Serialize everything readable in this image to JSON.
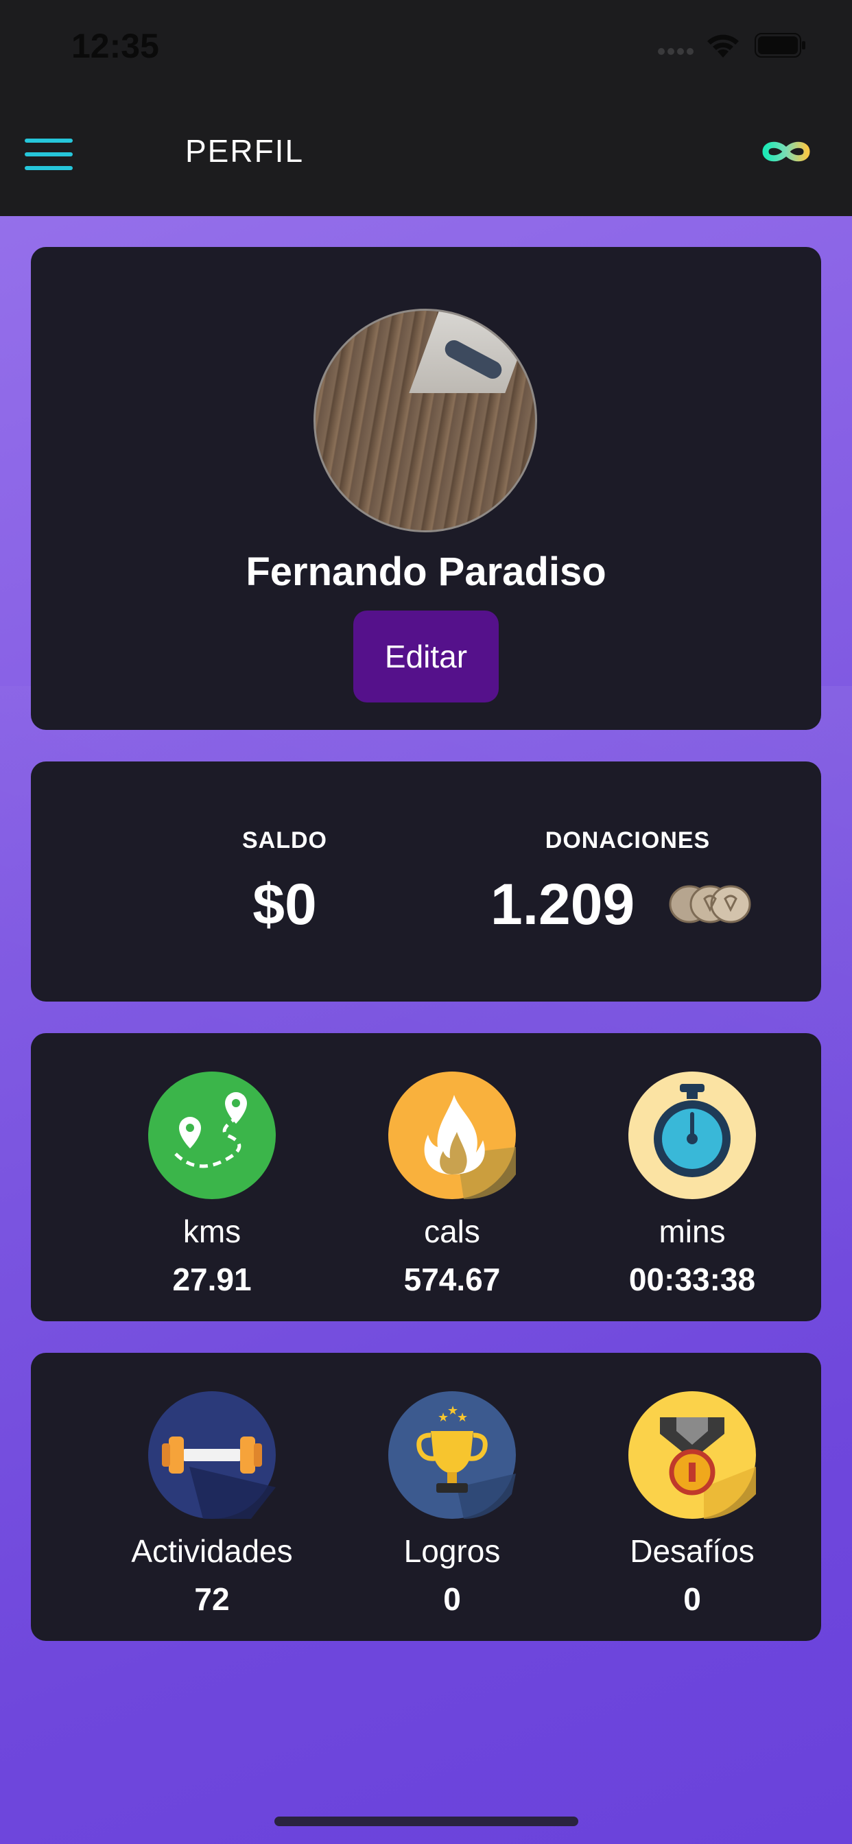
{
  "status_bar": {
    "time": "12:35"
  },
  "nav": {
    "title": "PERFIL",
    "menu_icon": "hamburger-icon",
    "brand_icon": "infinity-logo-icon"
  },
  "profile": {
    "name": "Fernando Paradiso",
    "edit_label": "Editar"
  },
  "balance": {
    "saldo_label": "SALDO",
    "saldo_value": "$0",
    "donaciones_label": "DONACIONES",
    "donaciones_value": "1.209"
  },
  "metrics": [
    {
      "icon": "route-map-icon",
      "label": "kms",
      "value": "27.91"
    },
    {
      "icon": "flame-icon",
      "label": "cals",
      "value": "574.67"
    },
    {
      "icon": "stopwatch-icon",
      "label": "mins",
      "value": "00:33:38"
    }
  ],
  "achievements": [
    {
      "icon": "dumbbell-icon",
      "label": "Actividades",
      "value": "72"
    },
    {
      "icon": "trophy-icon",
      "label": "Logros",
      "value": "0"
    },
    {
      "icon": "medal-icon",
      "label": "Desafíos",
      "value": "0"
    }
  ],
  "colors": {
    "accent_cyan": "#26c6da",
    "edit_button": "#55118b",
    "card_background": "#1c1b27",
    "background_purple": "#7b55e0"
  }
}
